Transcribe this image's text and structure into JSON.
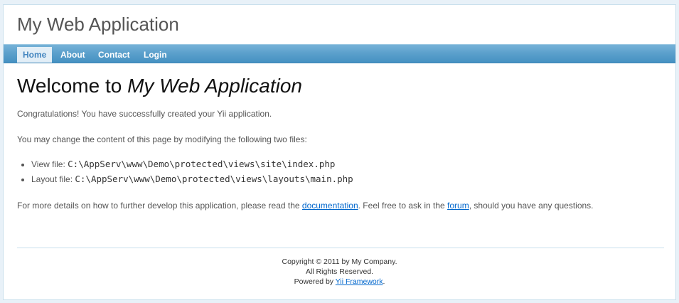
{
  "header": {
    "logo": "My Web Application"
  },
  "mainmenu": {
    "items": [
      {
        "label": "Home",
        "active": true
      },
      {
        "label": "About",
        "active": false
      },
      {
        "label": "Contact",
        "active": false
      },
      {
        "label": "Login",
        "active": false
      }
    ]
  },
  "content": {
    "heading_prefix": "Welcome to ",
    "heading_app": "My Web Application",
    "congrats": "Congratulations! You have successfully created your Yii application.",
    "change_intro": "You may change the content of this page by modifying the following two files:",
    "files": [
      {
        "label": "View file: ",
        "path": "C:\\AppServ\\www\\Demo\\protected\\views\\site\\index.php"
      },
      {
        "label": "Layout file: ",
        "path": "C:\\AppServ\\www\\Demo\\protected\\views\\layouts\\main.php"
      }
    ],
    "details_prefix": "For more details on how to further develop this application, please read the ",
    "documentation_link": "documentation",
    "details_middle": ". Feel free to ask in the ",
    "forum_link": "forum",
    "details_suffix": ", should you have any questions."
  },
  "footer": {
    "copyright": "Copyright © 2011 by My Company.",
    "rights": "All Rights Reserved.",
    "powered_prefix": "Powered by ",
    "powered_link": "Yii Framework",
    "powered_suffix": "."
  }
}
